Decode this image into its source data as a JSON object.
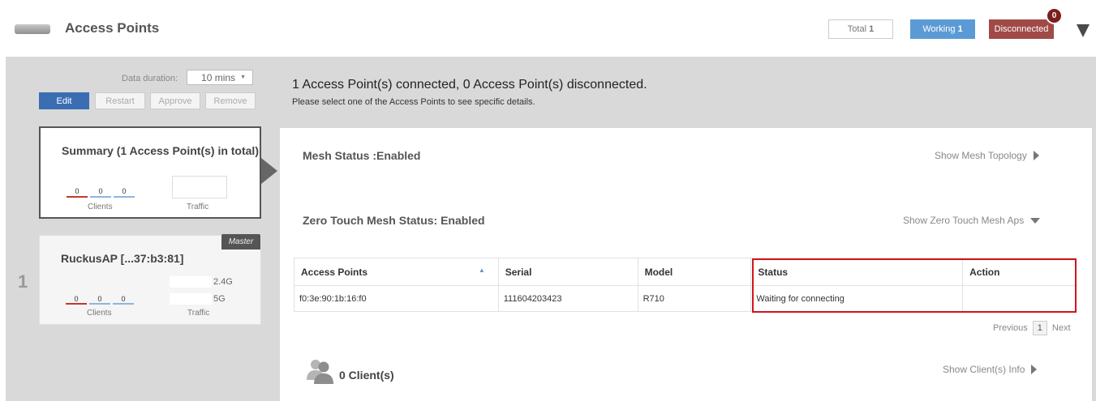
{
  "header": {
    "title": "Access Points",
    "filters": {
      "total_label": "Total",
      "total_count": "1",
      "working_label": "Working",
      "working_count": "1",
      "disconnected_label": "Disconnected",
      "disconnected_badge": "0"
    }
  },
  "toolbar": {
    "duration_label": "Data duration:",
    "duration_value": "10 mins",
    "edit": "Edit",
    "restart": "Restart",
    "approve": "Approve",
    "remove": "Remove"
  },
  "message": {
    "headline": "1 Access Point(s) connected, 0 Access Point(s) disconnected.",
    "subline": "Please select one of the Access Points to see specific details."
  },
  "summary_card": {
    "title": "Summary (1 Access Point(s) in total)",
    "stats": [
      "0",
      "0",
      "0"
    ],
    "clients_label": "Clients",
    "traffic_label": "Traffic"
  },
  "ap_card": {
    "index": "1",
    "name": "RuckusAP [...37:b3:81]",
    "badge": "Master",
    "stats": [
      "0",
      "0",
      "0"
    ],
    "clients_label": "Clients",
    "traffic_label": "Traffic",
    "band_24": "2.4G",
    "band_5": "5G"
  },
  "mesh": {
    "status": "Mesh Status :Enabled",
    "topology_link": "Show Mesh Topology",
    "zero_touch_status": "Zero Touch Mesh Status: Enabled",
    "zero_touch_link": "Show Zero Touch Mesh Aps"
  },
  "table": {
    "columns": [
      "Access Points",
      "Serial",
      "Model",
      "Status",
      "Action"
    ],
    "rows": [
      {
        "access_point": "f0:3e:90:1b:16:f0",
        "serial": "111604203423",
        "model": "R710",
        "status": "Waiting for connecting",
        "action": ""
      }
    ]
  },
  "pager": {
    "previous": "Previous",
    "page": "1",
    "next": "Next"
  },
  "clients": {
    "title": "0 Client(s)",
    "info_link": "Show Client(s) Info"
  },
  "colors": {
    "accent_blue": "#5b9bd5",
    "edit_blue": "#3b6db3",
    "disconnected_red": "#a04a48",
    "highlight_red": "#d0151b"
  }
}
